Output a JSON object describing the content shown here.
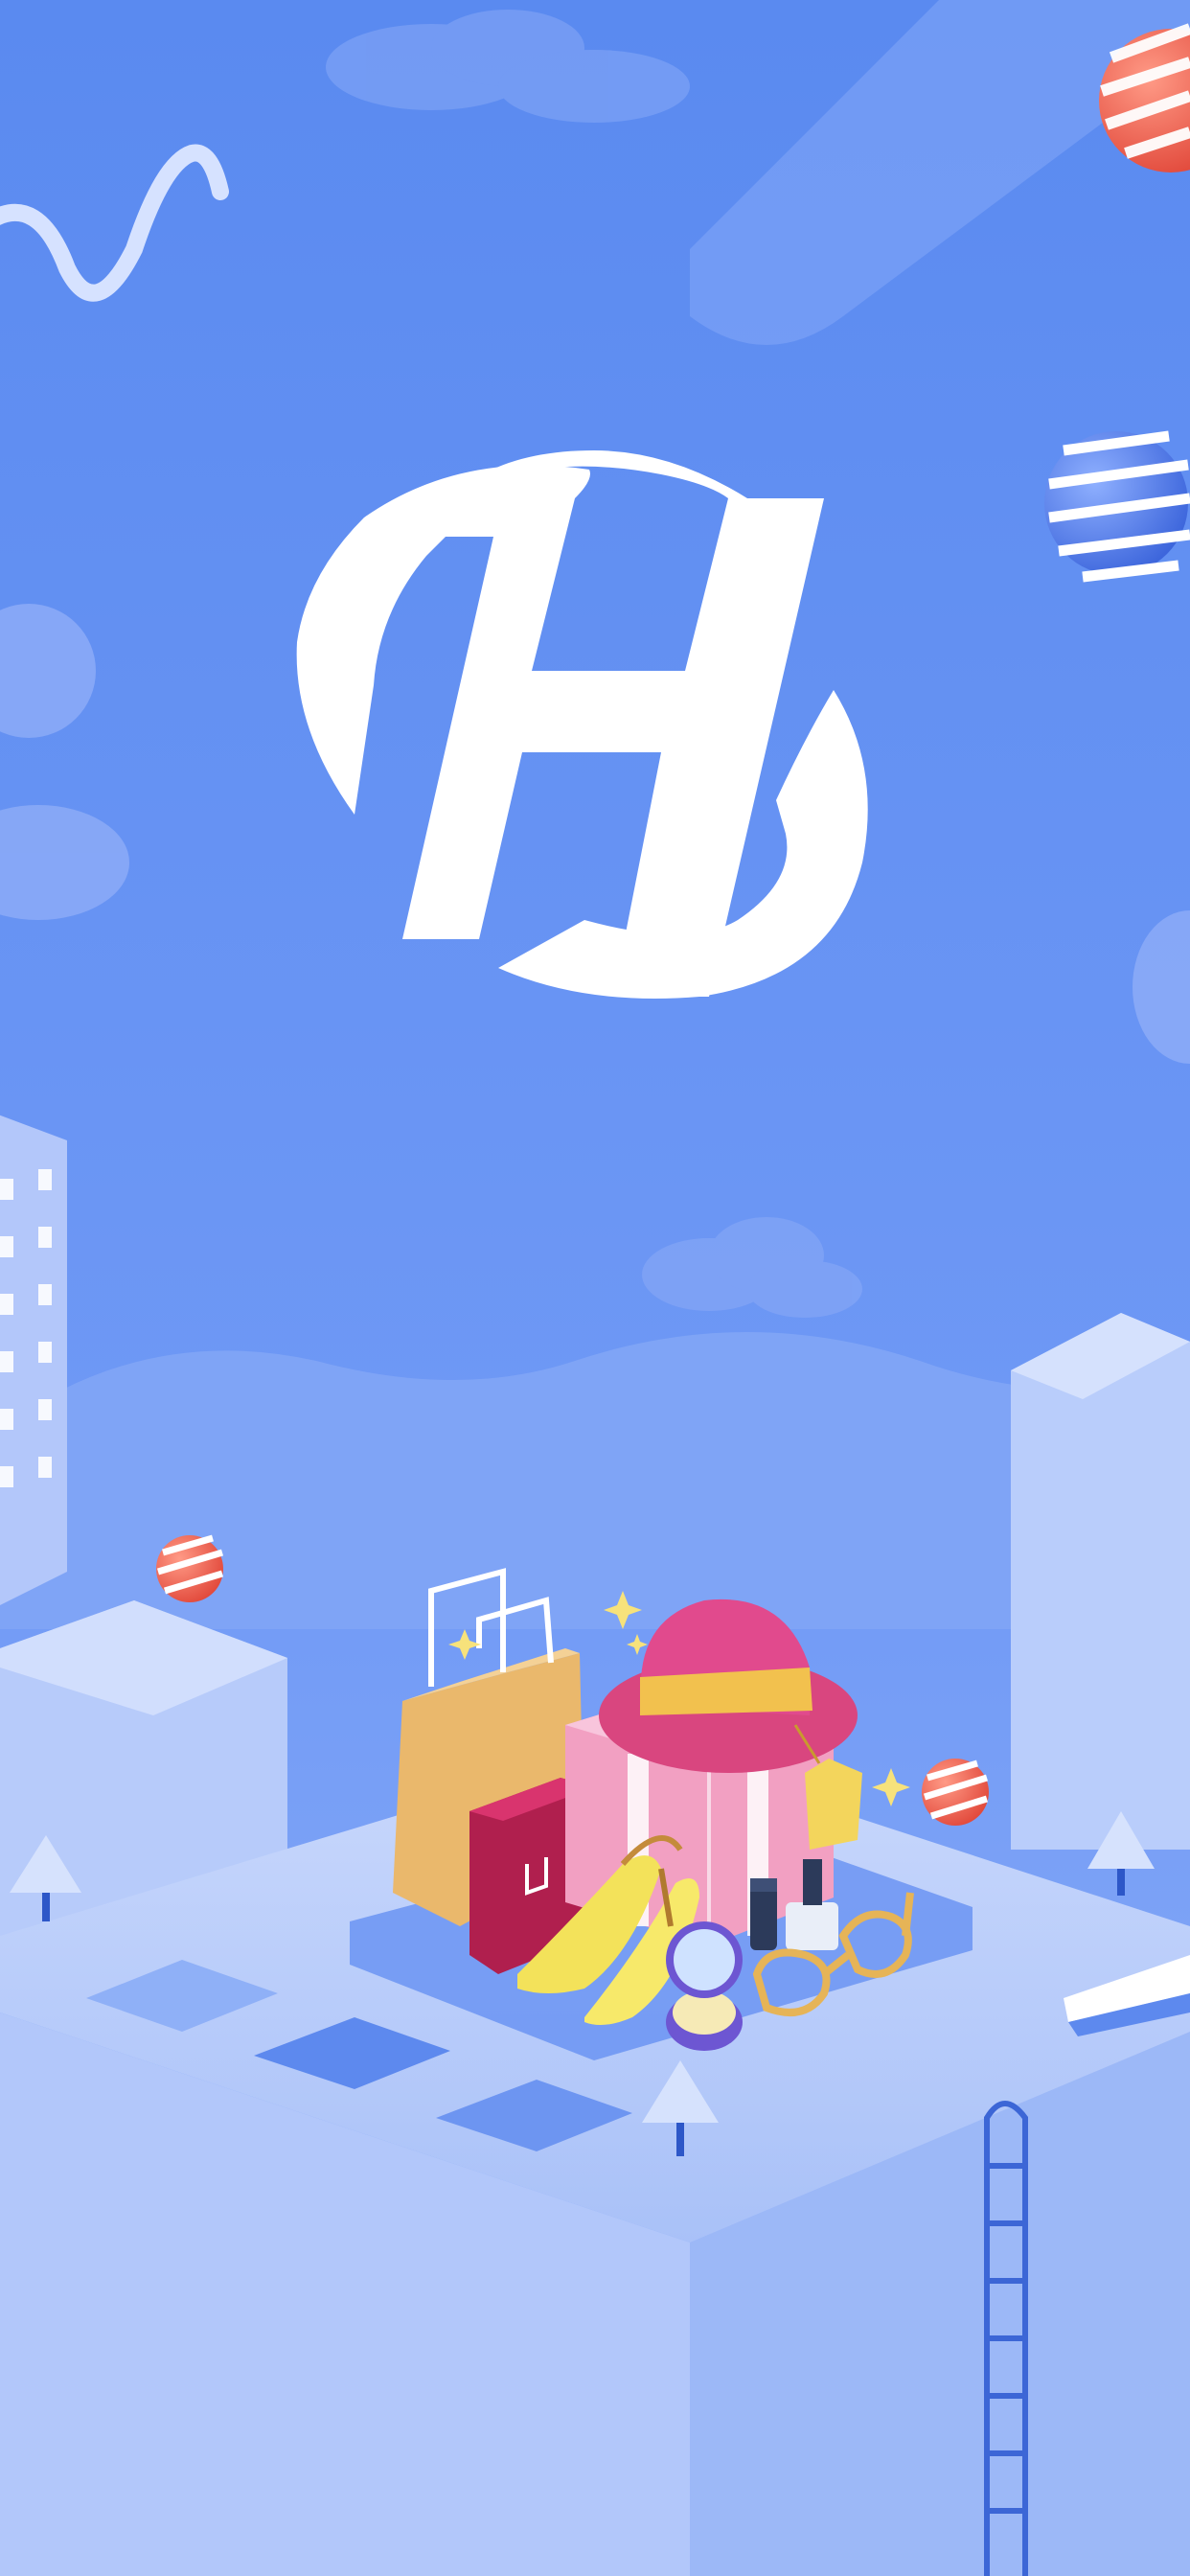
{
  "app": {
    "logo_letter": "H",
    "logo_name": "h-monogram-logo"
  },
  "colors": {
    "sky_top": "#5b8cf0",
    "sky_bottom": "#7aa2f7",
    "logo_white": "#ffffff",
    "building_light": "#c7d6fb",
    "building_mid": "#a9c0f7",
    "ball_red": "#f26a5c",
    "ball_blue": "#5b82ec",
    "bag_tan": "#e8b86d",
    "bag_red": "#b2204f",
    "gift_pink": "#f4a8c8",
    "hat_pink": "#e14a8d",
    "hat_band": "#f2c14e",
    "shoe_yellow": "#f3e45c",
    "compact_purple": "#6f5bd6",
    "glasses_gold": "#e7b75a"
  },
  "illustration": {
    "items": [
      "shopping-bags",
      "gift-box",
      "hat",
      "high-heels",
      "compact-mirror",
      "lipstick",
      "nail-polish",
      "sunglasses",
      "price-tag"
    ]
  }
}
